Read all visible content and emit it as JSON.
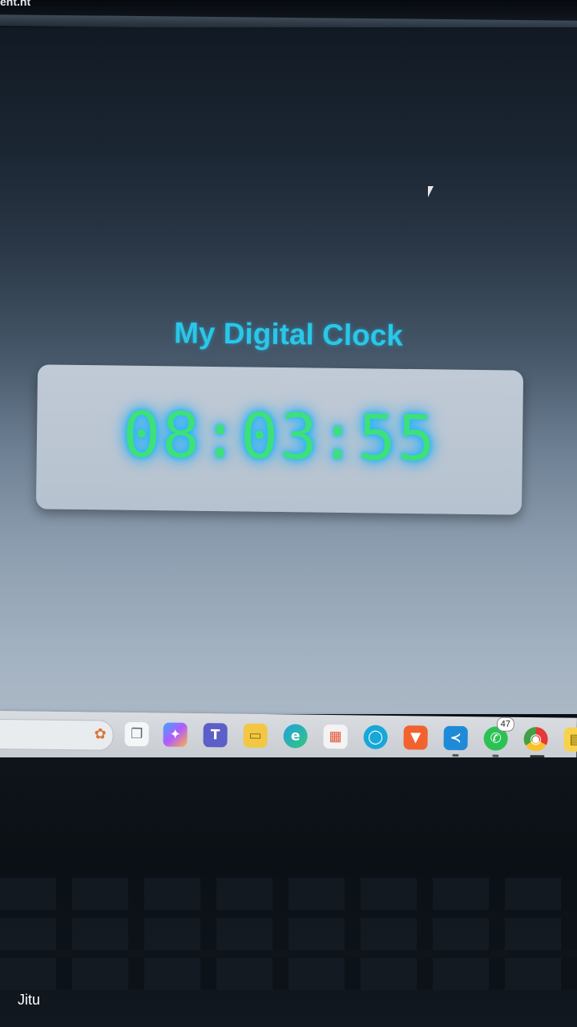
{
  "page": {
    "tab_fragment": "ent.ht"
  },
  "clock": {
    "title": "My Digital Clock",
    "time": "08:03:55",
    "title_color": "#29c7e8",
    "digit_color": "#3ee07a",
    "glow_color": "#1fb4ff"
  },
  "taskbar": {
    "apps": [
      {
        "name": "task-view-icon",
        "glyph": "❐"
      },
      {
        "name": "copilot-icon",
        "glyph": "✦"
      },
      {
        "name": "teams-icon",
        "glyph": "T"
      },
      {
        "name": "file-explorer-icon",
        "glyph": "▭"
      },
      {
        "name": "edge-icon",
        "glyph": "e"
      },
      {
        "name": "store-icon",
        "glyph": "▦"
      },
      {
        "name": "alexa-icon",
        "glyph": "◯"
      },
      {
        "name": "brave-icon",
        "glyph": "▼"
      },
      {
        "name": "vscode-icon",
        "glyph": "≺"
      },
      {
        "name": "whatsapp-icon",
        "glyph": "✆"
      },
      {
        "name": "chrome-icon",
        "glyph": "◉"
      },
      {
        "name": "sticky-notes-icon",
        "glyph": "▤"
      }
    ],
    "whatsapp_badge": "47"
  },
  "watermark": {
    "text": "Jitu"
  }
}
